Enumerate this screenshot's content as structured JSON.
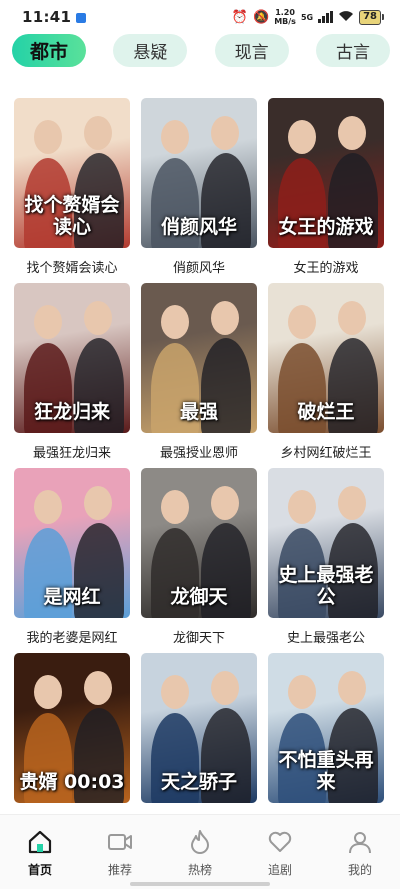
{
  "status_bar": {
    "time": "11:41",
    "net_speed_value": "1.20",
    "net_speed_unit": "MB/s",
    "net_generation": "5G",
    "battery": "78"
  },
  "tabs": [
    {
      "label": "都市",
      "active": true
    },
    {
      "label": "悬疑",
      "active": false
    },
    {
      "label": "现言",
      "active": false
    },
    {
      "label": "古言",
      "active": false
    }
  ],
  "dramas": [
    {
      "title": "找个赘婿会读心",
      "poster_text": "找个赘婿会读心",
      "palette": [
        "#f1ddc9",
        "#b23a2f"
      ]
    },
    {
      "title": "俏颜风华",
      "poster_text": "俏颜风华",
      "palette": [
        "#cfd6db",
        "#4b5561"
      ]
    },
    {
      "title": "女王的游戏",
      "poster_text": "女王的游戏",
      "palette": [
        "#3a2d2a",
        "#8e1e1a"
      ]
    },
    {
      "title": "最强狂龙归来",
      "poster_text": "狂龙归来",
      "palette": [
        "#d8c6c1",
        "#5a1a1a"
      ]
    },
    {
      "title": "最强授业恩师",
      "poster_text": "最强",
      "palette": [
        "#6a5a4f",
        "#c9a36b"
      ]
    },
    {
      "title": "乡村网红破烂王",
      "poster_text": "破烂王",
      "palette": [
        "#e8e1d5",
        "#7a4d2e"
      ]
    },
    {
      "title": "我的老婆是网红",
      "poster_text": "是网红",
      "palette": [
        "#e9a2b9",
        "#5a9fd8"
      ]
    },
    {
      "title": "龙御天下",
      "poster_text": "龙御天",
      "palette": [
        "#8d8a86",
        "#2f2c2a"
      ]
    },
    {
      "title": "史上最强老公",
      "poster_text": "史上最强老公",
      "palette": [
        "#d9dde3",
        "#3a4a63"
      ]
    },
    {
      "title": "贵婿",
      "poster_text": "贵婿 00:03",
      "palette": [
        "#3a1d10",
        "#b9641e"
      ]
    },
    {
      "title": "天之骄子",
      "poster_text": "天之骄子",
      "palette": [
        "#c7d3de",
        "#1d3a63"
      ]
    },
    {
      "title": "不怕重头再来",
      "poster_text": "不怕重头再来",
      "palette": [
        "#cfdce5",
        "#2e4f7a"
      ]
    }
  ],
  "bottom_nav": [
    {
      "label": "首页",
      "icon": "home-icon",
      "active": true
    },
    {
      "label": "推荐",
      "icon": "video-icon",
      "active": false
    },
    {
      "label": "热榜",
      "icon": "flame-icon",
      "active": false
    },
    {
      "label": "追剧",
      "icon": "heart-icon",
      "active": false
    },
    {
      "label": "我的",
      "icon": "person-icon",
      "active": false
    }
  ],
  "colors": {
    "accent": "#24d2a7",
    "tab_bg": "#dff3ec"
  }
}
